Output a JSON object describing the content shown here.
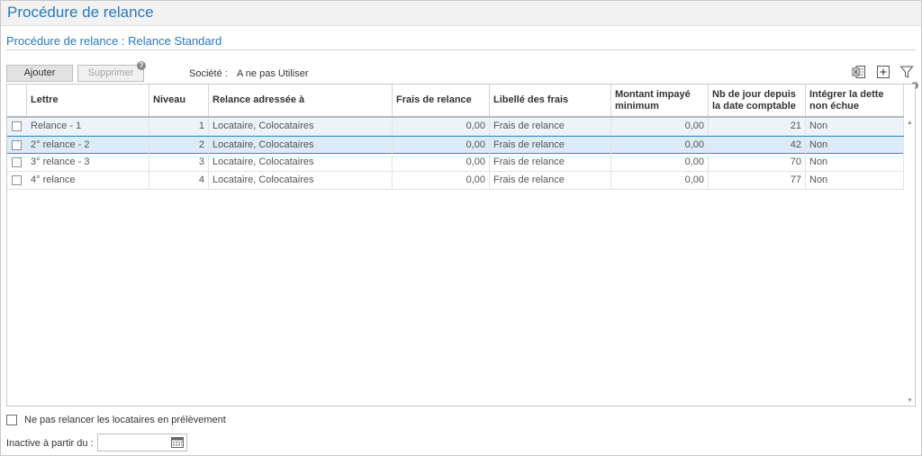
{
  "window": {
    "title": "Procédure de relance"
  },
  "page": {
    "subtitle": "Procédure de relance : Relance Standard"
  },
  "toolbar": {
    "add_label": "Ajouter",
    "delete_label": "Supprimer",
    "help_glyph": "?",
    "societe_label": "Société :",
    "societe_value": "A ne pas Utiliser",
    "icons": [
      "excel-export-icon",
      "add-column-icon",
      "filter-icon"
    ]
  },
  "grid": {
    "headers": {
      "lettre": "Lettre",
      "niveau": "Niveau",
      "relance": "Relance adressée à",
      "frais": "Frais de relance",
      "libelle": "Libellé des frais",
      "montant": "Montant impayé minimum",
      "nbjour": "Nb de jour depuis la date comptable",
      "integrer": "Intégrer la dette non échue"
    },
    "rows": [
      {
        "lettre": "Relance - 1",
        "niveau": "1",
        "relance": "Locataire, Colocataires",
        "frais": "0,00",
        "libelle": "Frais de relance",
        "montant": "0,00",
        "nbjour": "21",
        "integrer": "Non"
      },
      {
        "lettre": "2° relance - 2",
        "niveau": "2",
        "relance": "Locataire, Colocataires",
        "frais": "0,00",
        "libelle": "Frais de relance",
        "montant": "0,00",
        "nbjour": "42",
        "integrer": "Non"
      },
      {
        "lettre": "3° relance - 3",
        "niveau": "3",
        "relance": "Locataire, Colocataires",
        "frais": "0,00",
        "libelle": "Frais de relance",
        "montant": "0,00",
        "nbjour": "70",
        "integrer": "Non"
      },
      {
        "lettre": "4° relance",
        "niveau": "4",
        "relance": "Locataire, Colocataires",
        "frais": "0,00",
        "libelle": "Frais de relance",
        "montant": "0,00",
        "nbjour": "77",
        "integrer": "Non"
      }
    ]
  },
  "footer": {
    "no_direct_debit_label": "Ne pas relancer les locataires en prélèvement",
    "inactive_label": "Inactive à partir du :",
    "inactive_value": ""
  },
  "colors": {
    "accent": "#2a79b8",
    "selection": "#dcebf5",
    "selection_border": "#2b8fc7"
  }
}
